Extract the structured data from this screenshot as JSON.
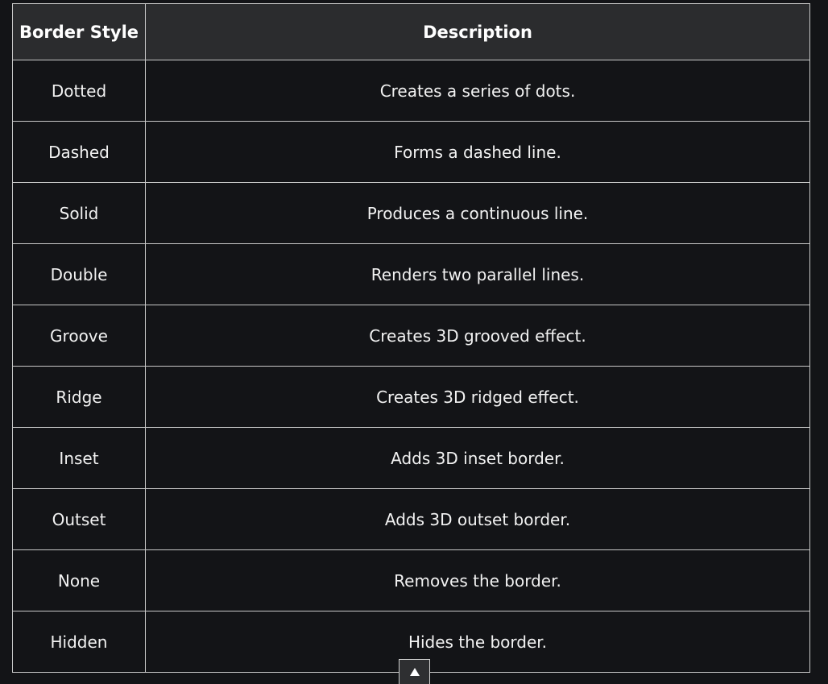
{
  "table": {
    "headers": [
      "Border Style",
      "Description"
    ],
    "rows": [
      {
        "style": "Dotted",
        "description": "Creates a series of dots."
      },
      {
        "style": "Dashed",
        "description": "Forms a dashed line."
      },
      {
        "style": "Solid",
        "description": "Produces a continuous line."
      },
      {
        "style": "Double",
        "description": "Renders two parallel lines."
      },
      {
        "style": "Groove",
        "description": "Creates 3D grooved effect."
      },
      {
        "style": "Ridge",
        "description": "Creates 3D ridged effect."
      },
      {
        "style": "Inset",
        "description": "Adds 3D inset border."
      },
      {
        "style": "Outset",
        "description": "Adds 3D outset border."
      },
      {
        "style": "None",
        "description": "Removes the border."
      },
      {
        "style": "Hidden",
        "description": "Hides the border."
      }
    ]
  },
  "scroll_top_button": {
    "icon": "triangle-up-icon"
  },
  "colors": {
    "page_background": "#131417",
    "header_background": "#2b2c2e",
    "border": "#c8c8c8",
    "text": "#f2f2f2"
  }
}
